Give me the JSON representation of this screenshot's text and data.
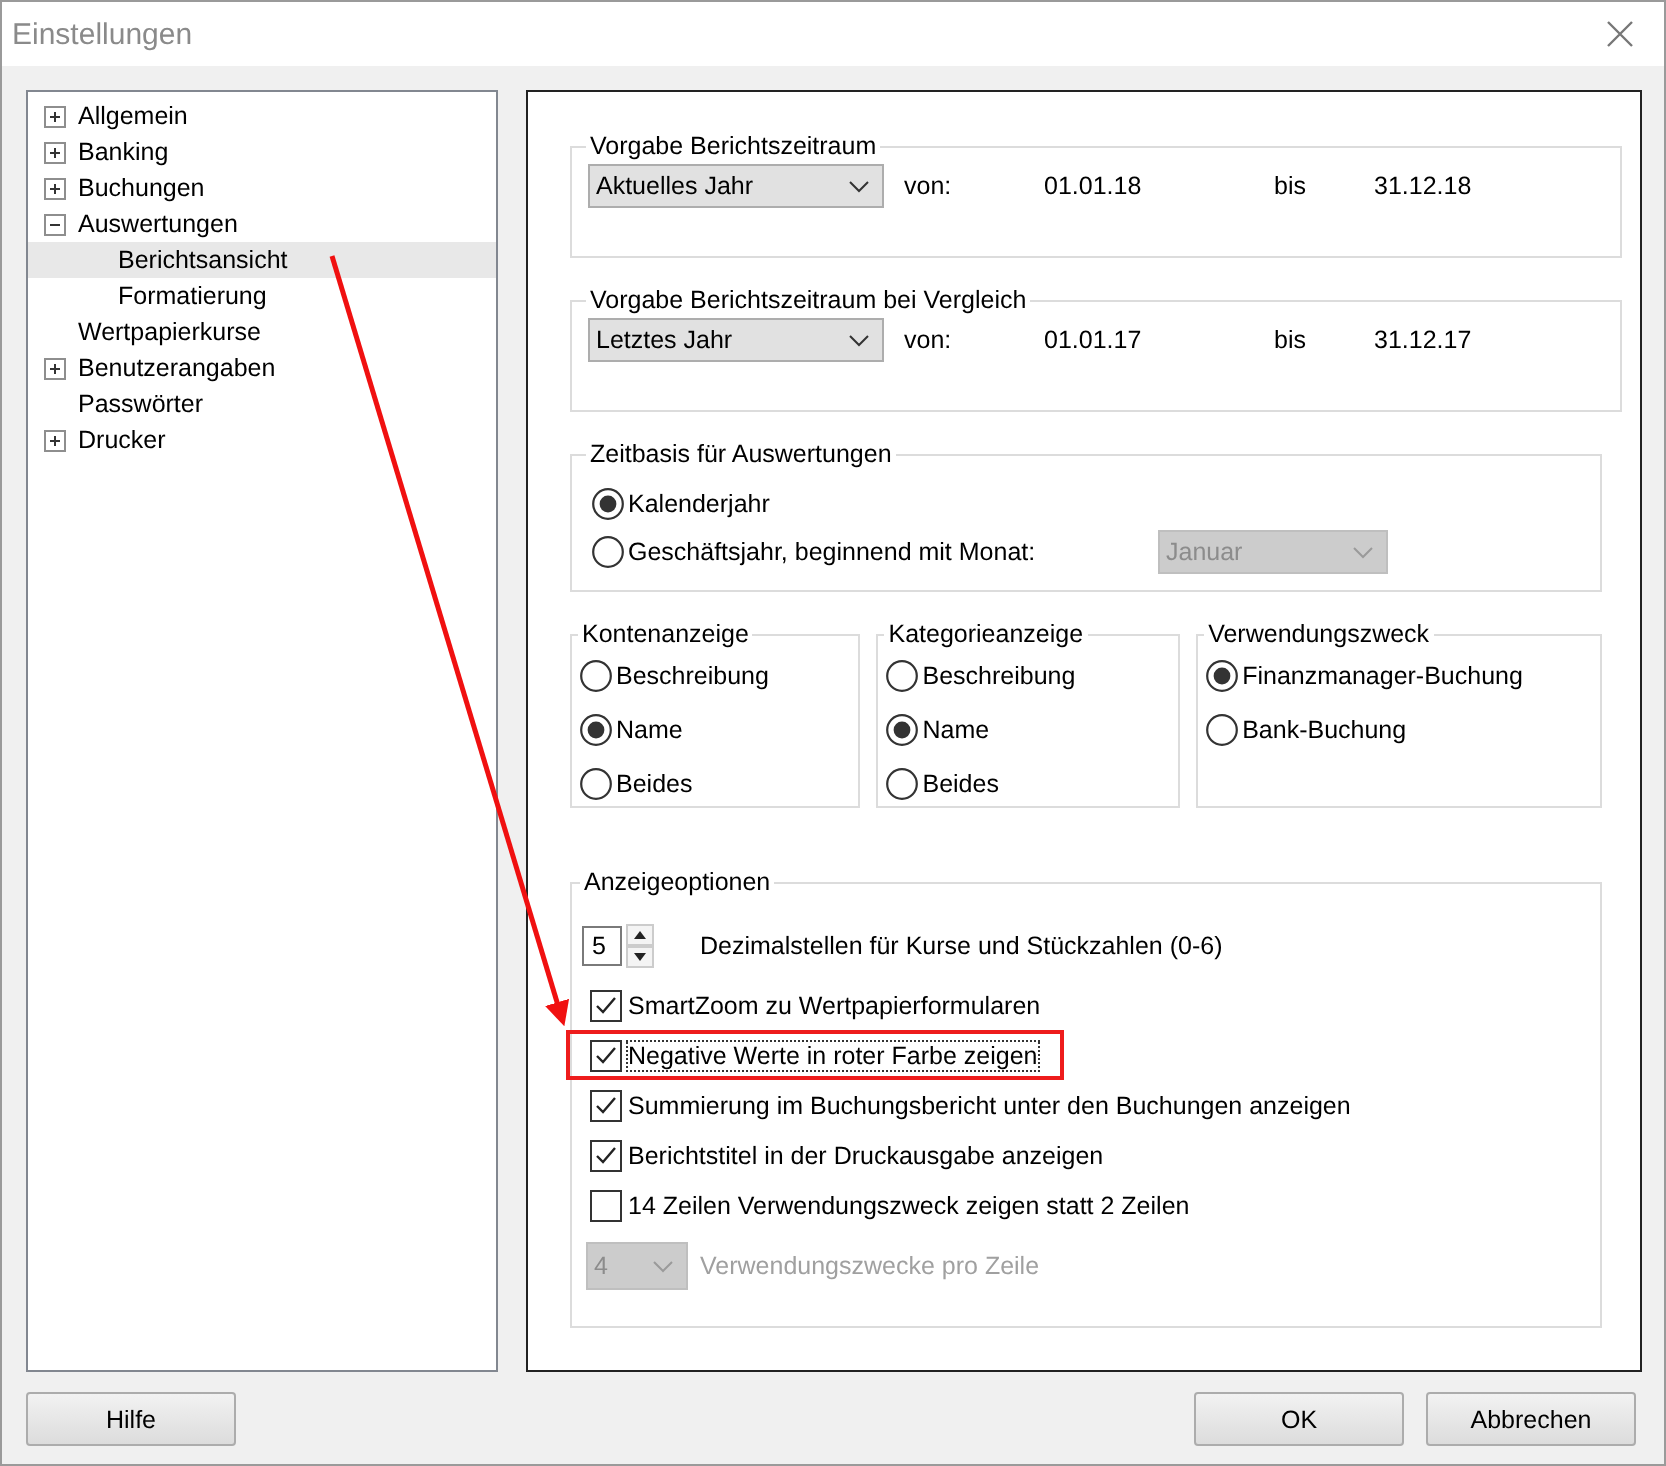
{
  "window": {
    "title": "Einstellungen"
  },
  "tree": [
    {
      "label": "Allgemein",
      "expandable": true,
      "expanded": false,
      "selected": false
    },
    {
      "label": "Banking",
      "expandable": true,
      "expanded": false,
      "selected": false
    },
    {
      "label": "Buchungen",
      "expandable": true,
      "expanded": false,
      "selected": false
    },
    {
      "label": "Auswertungen",
      "expandable": true,
      "expanded": true,
      "selected": false,
      "children": [
        {
          "label": "Berichtsansicht",
          "expandable": false,
          "selected": true
        },
        {
          "label": "Formatierung",
          "expandable": false,
          "selected": false
        }
      ]
    },
    {
      "label": "Wertpapierkurse",
      "expandable": false,
      "selected": false
    },
    {
      "label": "Benutzerangaben",
      "expandable": true,
      "expanded": false,
      "selected": false
    },
    {
      "label": "Passwörter",
      "expandable": false,
      "selected": false
    },
    {
      "label": "Drucker",
      "expandable": true,
      "expanded": false,
      "selected": false
    }
  ],
  "periods": [
    {
      "legend": "Vorgabe Berichtszeitraum",
      "dropdown": "Aktuelles Jahr",
      "from_label": "von:",
      "from": "01.01.18",
      "to_label": "bis",
      "to": "31.12.18"
    },
    {
      "legend": "Vorgabe Berichtszeitraum bei Vergleich",
      "dropdown": "Letztes Jahr",
      "from_label": "von:",
      "from": "01.01.17",
      "to_label": "bis",
      "to": "31.12.17"
    }
  ],
  "time_basis": {
    "legend": "Zeitbasis für Auswertungen",
    "options": [
      {
        "label": "Kalenderjahr",
        "selected": true
      },
      {
        "label": "Geschäftsjahr, beginnend mit Monat:",
        "selected": false
      }
    ],
    "month_dropdown": {
      "value": "Januar",
      "disabled": true
    }
  },
  "radio_groups": [
    {
      "legend": "Kontenanzeige",
      "options": [
        {
          "label": "Beschreibung",
          "selected": false
        },
        {
          "label": "Name",
          "selected": true
        },
        {
          "label": "Beides",
          "selected": false
        }
      ]
    },
    {
      "legend": "Kategorieanzeige",
      "options": [
        {
          "label": "Beschreibung",
          "selected": false
        },
        {
          "label": "Name",
          "selected": true
        },
        {
          "label": "Beides",
          "selected": false
        }
      ]
    },
    {
      "legend": "Verwendungszweck",
      "options": [
        {
          "label": "Finanzmanager-Buchung",
          "selected": true
        },
        {
          "label": "Bank-Buchung",
          "selected": false
        }
      ]
    }
  ],
  "display_options": {
    "legend": "Anzeigeoptionen",
    "decimals": {
      "value": "5",
      "label": "Dezimalstellen für Kurse und Stückzahlen (0-6)"
    },
    "checkboxes": [
      {
        "label": "SmartZoom zu Wertpapierformularen",
        "checked": true,
        "highlighted": false
      },
      {
        "label": "Negative Werte in roter Farbe zeigen",
        "checked": true,
        "highlighted": true
      },
      {
        "label": "Summierung im Buchungsbericht unter den Buchungen anzeigen",
        "checked": true,
        "highlighted": false
      },
      {
        "label": "Berichtstitel in der Druckausgabe anzeigen",
        "checked": true,
        "highlighted": false
      },
      {
        "label": "14 Zeilen Verwendungszweck zeigen statt 2 Zeilen",
        "checked": false,
        "highlighted": false
      }
    ],
    "per_line": {
      "value": "4",
      "label": "Verwendungszwecke pro Zeile",
      "disabled": true
    }
  },
  "buttons": [
    {
      "label": "Hilfe"
    },
    {
      "label": "OK"
    },
    {
      "label": "Abbrechen"
    }
  ]
}
